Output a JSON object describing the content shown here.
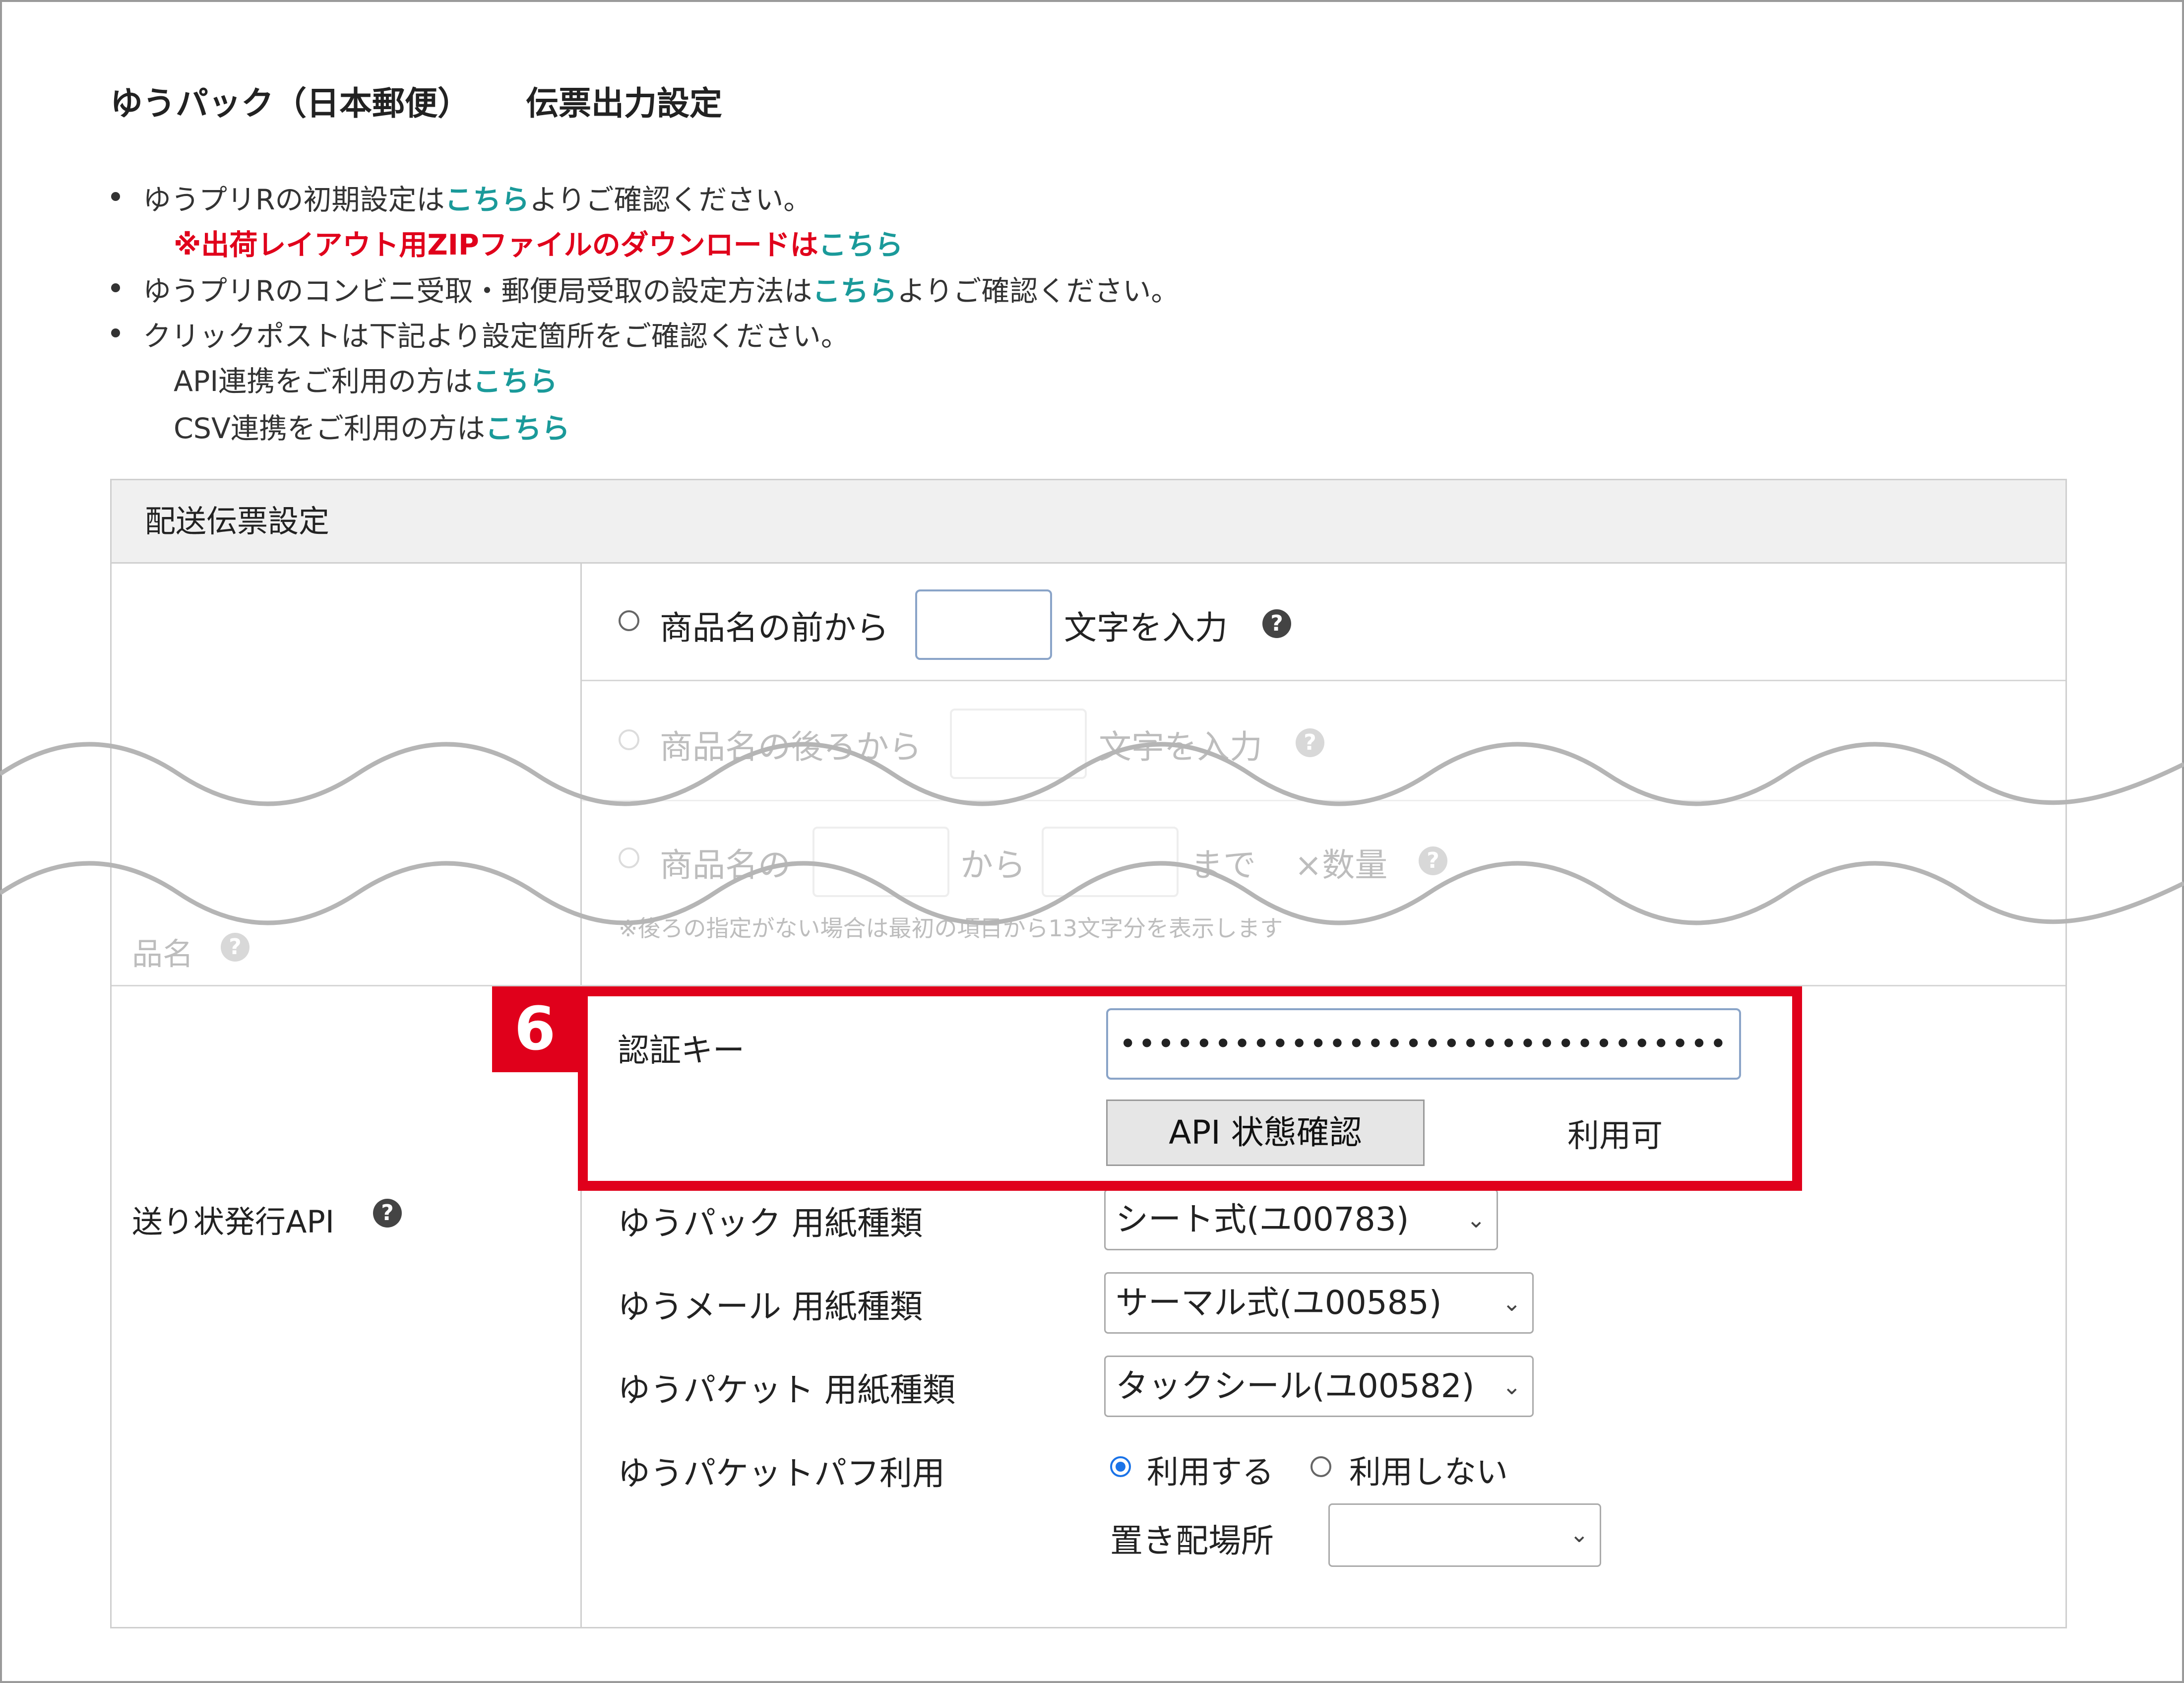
{
  "page_title": {
    "part1": "ゆうパック（日本郵便）",
    "part2": "伝票出力設定"
  },
  "notes": {
    "line1_prefix": "ゆうプリRの初期設定は",
    "line1_link": "こちら",
    "line1_suffix": "よりご確認ください。",
    "line2_red": "※出荷レイアウト用ZIPファイルのダウンロードは",
    "line2_link": "こちら",
    "line3_prefix": "ゆうプリRのコンビニ受取・郵便局受取の設定方法は",
    "line3_link": "こちら",
    "line3_suffix": "よりご確認ください。",
    "line4": "クリックポストは下記より設定箇所をご確認ください。",
    "line5_prefix": "API連携をご利用の方は",
    "line5_link": "こちら",
    "line6_prefix": "CSV連携をご利用の方は",
    "line6_link": "こちら"
  },
  "panel": {
    "header": "配送伝票設定"
  },
  "product_name": {
    "label": "品名",
    "opt1_before": "商品名の前から",
    "opt1_after": "文字を入力",
    "opt2_before": "商品名の後ろから",
    "opt2_after": "文字を入力",
    "opt3_before": "商品名の",
    "opt3_mid": "から",
    "opt3_end": "まで",
    "opt3_qty": "×数量",
    "hint": "※後ろの指定がない場合は最初の項目から13文字分を表示します"
  },
  "api": {
    "label": "送り状発行API",
    "auth_key_label": "認証キー",
    "auth_key_value": "••••••••••••••••••••••••••••••••",
    "check_button": "API 状態確認",
    "status": "利用可",
    "yupack_label": "ゆうパック 用紙種類",
    "yupack_value": "シート式(ユ00783)",
    "yumail_label": "ゆうメール 用紙種類",
    "yumail_value": "サーマル式(ユ00585)",
    "yupacket_label": "ゆうパケット 用紙種類",
    "yupacket_value": "タックシール(ユ00582)",
    "puff_label": "ゆうパケットパフ利用",
    "puff_use": "利用する",
    "puff_nouse": "利用しない",
    "place_label": "置き配場所",
    "place_value": ""
  },
  "annotation": {
    "step": "6",
    "color": "#e0001b"
  },
  "colors": {
    "link": "#1a9a9a",
    "accent_red": "#e0001b",
    "radio_selected": "#1a73e8"
  },
  "icons": {
    "help": "question-circle-icon",
    "chevron": "chevron-down-icon"
  }
}
